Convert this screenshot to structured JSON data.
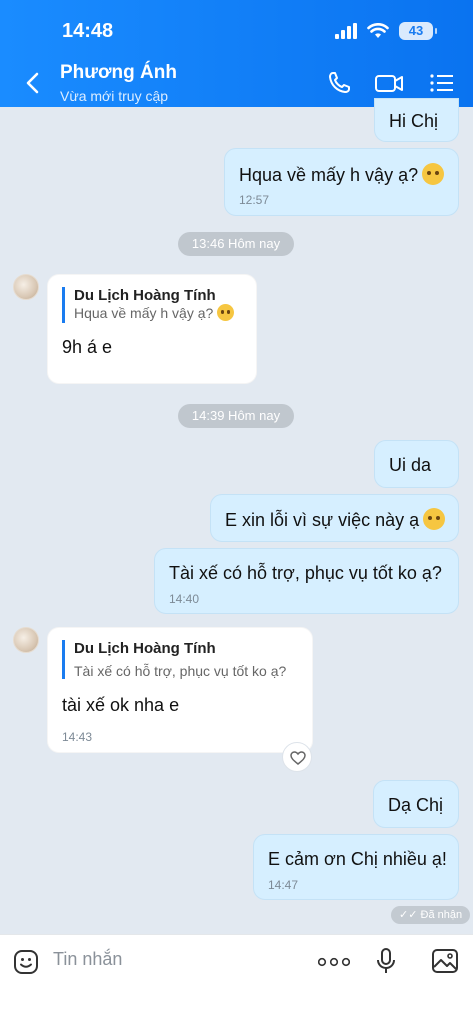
{
  "status_bar": {
    "time": "14:48",
    "battery": "43"
  },
  "header": {
    "title": "Phương Ánh",
    "subtitle": "Vừa mới truy cập"
  },
  "messages": {
    "m1": {
      "text": "Hi Chị"
    },
    "m2": {
      "text": "Hqua về mấy h vậy ạ?",
      "time": "12:57"
    },
    "divider1": "13:46 Hôm nay",
    "m3": {
      "quote_name": "Du Lịch Hoàng Tính",
      "quote_text": "Hqua về mấy h vậy ạ?",
      "text": "9h á e"
    },
    "divider2": "14:39 Hôm nay",
    "m4": {
      "text": "Ui da"
    },
    "m5": {
      "text": "E xin lỗi vì sự việc này ạ"
    },
    "m6": {
      "text": "Tài xế có hỗ trợ, phục vụ tốt ko ạ?",
      "time": "14:40"
    },
    "m7": {
      "quote_name": "Du Lịch Hoàng Tính",
      "quote_text": "Tài xế có hỗ trợ, phục vụ tốt ko ạ?",
      "text": "tài xế ok nha e",
      "time": "14:43"
    },
    "m8": {
      "text": "Dạ Chị"
    },
    "m9": {
      "text": "E cảm ơn Chị nhiều ạ!",
      "time": "14:47"
    },
    "seen": "Đã nhận"
  },
  "composer": {
    "placeholder": "Tin nhắn"
  },
  "colors": {
    "header": "#0a73f0",
    "my_bubble": "#d6efff",
    "chat_bg": "#e2e9f1"
  }
}
